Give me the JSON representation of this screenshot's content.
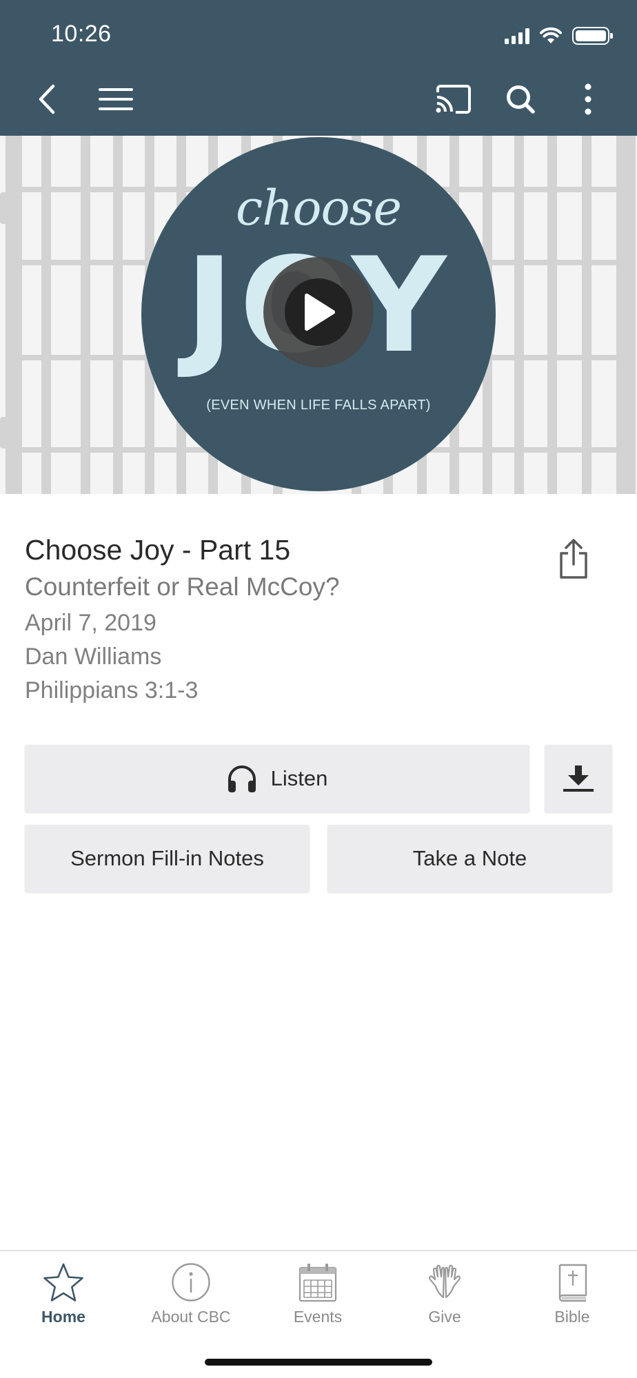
{
  "status_bar": {
    "time": "10:26"
  },
  "header": {
    "icons": [
      "back-arrow-icon",
      "menu-icon",
      "cast-icon",
      "search-icon",
      "more-vertical-icon"
    ],
    "background": "#3d5766"
  },
  "hero": {
    "script_word": "choose",
    "main_word": "JOY",
    "tagline": "(EVEN WHEN LIFE FALLS APART)",
    "circle_color": "#3d5766",
    "text_color": "#d4ebf1"
  },
  "sermon": {
    "title": "Choose Joy - Part 15",
    "subtitle": "Counterfeit or Real McCoy?",
    "date": "April 7, 2019",
    "speaker": "Dan Williams",
    "scripture": "Philippians 3:1-3"
  },
  "actions": {
    "listen_label": "Listen",
    "notes_label": "Sermon Fill-in Notes",
    "take_note_label": "Take a Note"
  },
  "tabbar": {
    "tabs": [
      {
        "label": "Home",
        "icon": "star-icon",
        "active": true
      },
      {
        "label": "About CBC",
        "icon": "info-icon",
        "active": false
      },
      {
        "label": "Events",
        "icon": "calendar-icon",
        "active": false
      },
      {
        "label": "Give",
        "icon": "praying-hands-icon",
        "active": false
      },
      {
        "label": "Bible",
        "icon": "bible-icon",
        "active": false
      }
    ],
    "active_color": "#3d5766",
    "inactive_color": "#8a8a8a"
  }
}
